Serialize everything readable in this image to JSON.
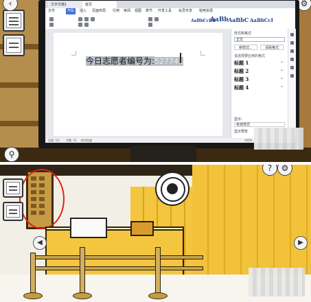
{
  "editor": {
    "tabs": [
      "文字文稿1",
      "首页"
    ],
    "menus": [
      "文件",
      "开始",
      "插入",
      "页面布局",
      "引用",
      "审阅",
      "视图",
      "章节",
      "开发工具",
      "会员专享",
      "稻壳资源"
    ],
    "active_menu": "开始",
    "style_previews": [
      "AaBbCcDd",
      "AaBb",
      "AaBbC",
      "AaBbCcI"
    ],
    "document_line": {
      "label": "今日志愿者编号为:",
      "value": "527741"
    },
    "style_pane": {
      "title": "样式和格式",
      "current_style": "正文",
      "new_style_button": "新样式...",
      "clear_format_button": "清除格式",
      "apply_label": "请选择要应用的格式",
      "styles": [
        "标题 1",
        "标题 2",
        "标题 3",
        "标题 4"
      ],
      "show_label": "显示:",
      "show_option": "有效样式",
      "preview_checkbox": "显示预览"
    },
    "status": {
      "page": "页面: 1/1",
      "words": "字数: 11",
      "spell": "拼写检查",
      "zoom": "100%"
    }
  },
  "colors": {
    "highlight_circle": "#e0201b",
    "counter_yellow": "#f4c53f"
  },
  "icons": {
    "search": "magnifier-icon",
    "prev": "chevron-left-icon",
    "next": "chevron-right-icon",
    "settings": "gear-icon"
  }
}
